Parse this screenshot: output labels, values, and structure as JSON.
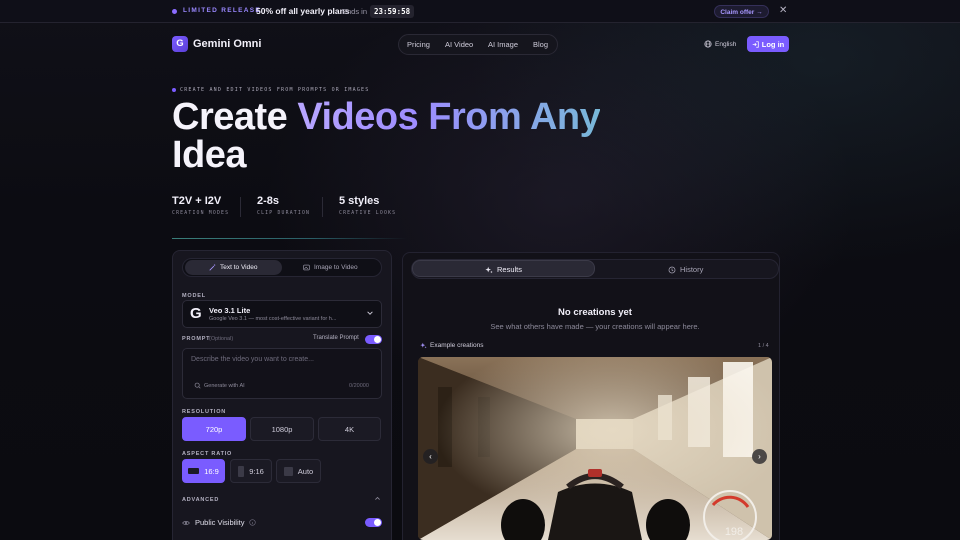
{
  "promo": {
    "tag": "LIMITED RELEASE",
    "offer": "50% off all yearly plans",
    "ends_label": "Ends in",
    "timer": "23:59:58",
    "claim": "Claim offer →",
    "close": "✕"
  },
  "brand": {
    "logo_letter": "G",
    "name": "Gemini Omni"
  },
  "nav": {
    "items": [
      "Pricing",
      "AI Video",
      "AI Image",
      "Blog"
    ],
    "language": "English",
    "login": "Log in"
  },
  "hero": {
    "eyebrow": "CREATE AND EDIT VIDEOS FROM PROMPTS OR IMAGES",
    "title_plain": "Create ",
    "title_grad": "Videos From Any",
    "title_line2": "Idea",
    "stats": [
      {
        "value": "T2V + I2V",
        "label": "CREATION MODES"
      },
      {
        "value": "2-8s",
        "label": "CLIP DURATION"
      },
      {
        "value": "5 styles",
        "label": "CREATIVE LOOKS"
      }
    ]
  },
  "generator": {
    "mode_tabs": [
      "Text to Video",
      "Image to Video"
    ],
    "model_label": "MODEL",
    "model_name": "Veo 3.1 Lite",
    "model_desc": "Google Veo 3.1 — most cost-effective variant for h...",
    "prompt_label": "PROMPT",
    "prompt_optional": "(Optional)",
    "translate_label": "Translate Prompt",
    "prompt_placeholder": "Describe the video you want to create...",
    "generate_ai": "Generate with AI",
    "counter": "0/20000",
    "resolution_label": "RESOLUTION",
    "resolutions": [
      "720p",
      "1080p",
      "4K"
    ],
    "aspect_label": "ASPECT RATIO",
    "aspects": [
      "16:9",
      "9:16",
      "Auto"
    ],
    "advanced_label": "ADVANCED",
    "visibility_label": "Public Visibility"
  },
  "results": {
    "tabs": [
      "Results",
      "History"
    ],
    "empty_title": "No creations yet",
    "empty_sub": "See what others have made — your creations will appear here.",
    "examples_label": "Example creations",
    "examples_count": "1 / 4",
    "speed_readout": "198"
  },
  "colors": {
    "accent": "#7a5cff",
    "bg": "#0b0b10",
    "panel": "#17161f"
  }
}
